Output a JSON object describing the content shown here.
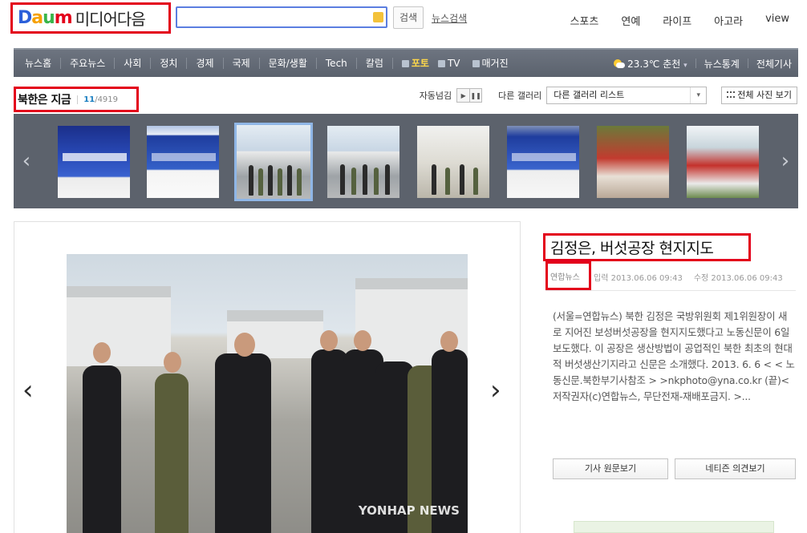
{
  "header": {
    "logo": {
      "daum": [
        "D",
        "a",
        "u",
        "m"
      ],
      "media": "미디어다음"
    },
    "search": {
      "placeholder": "",
      "button": "검색",
      "news_search": "뉴스검색"
    },
    "top_nav": [
      "스포츠",
      "연예",
      "라이프",
      "아고라",
      "view"
    ]
  },
  "gnb": {
    "items": [
      "뉴스홈",
      "주요뉴스",
      "사회",
      "정치",
      "경제",
      "국제",
      "문화/생활",
      "Tech",
      "칼럼"
    ],
    "media_tabs": [
      {
        "label": "포토",
        "active": true
      },
      {
        "label": "TV",
        "active": false
      },
      {
        "label": "매거진",
        "active": false
      }
    ],
    "weather": {
      "temp": "23.3℃",
      "city": "춘천",
      "dropdown": "▾"
    },
    "right_links": [
      "뉴스통계",
      "전체기사"
    ]
  },
  "gallery": {
    "title": "북한은 지금",
    "current": "11",
    "total": "/4919",
    "autoplay_label": "자동넘김",
    "play_icon": "▶",
    "pause_icon": "❚❚",
    "other_gallery_label": "다른 갤러리",
    "select_value": "다른 갤러리 리스트",
    "select_arrow": "▾",
    "all_photos_button": "전체 사진 보기",
    "prev_arrow": "‹",
    "next_arrow": "›"
  },
  "main": {
    "prev_arrow": "‹",
    "next_arrow": "›",
    "watermark": "YONHAP NEWS"
  },
  "article": {
    "title": "김정은, 버섯공장 현지지도",
    "source": "연합뉴스",
    "input_time": "입력 2013.06.06 09:43",
    "update_time": "수정 2013.06.06 09:43",
    "body": "(서울=연합뉴스) 북한 김정은 국방위원회 제1위원장이 새로 지어진 보성버섯공장을 현지지도했다고 노동신문이 6일 보도했다. 이 공장은 생산방법이 공업적인 북한 최초의 현대적 버섯생산기지라고 신문은 소개했다. 2013. 6. 6 < < 노동신문.북한부기사참조 > >nkphoto@yna.co.kr (끝)< 저작권자(c)연합뉴스, 무단전재-재배포금지. >...",
    "btn_original": "기사 원문보기",
    "btn_comments": "네티즌 의견보기"
  }
}
